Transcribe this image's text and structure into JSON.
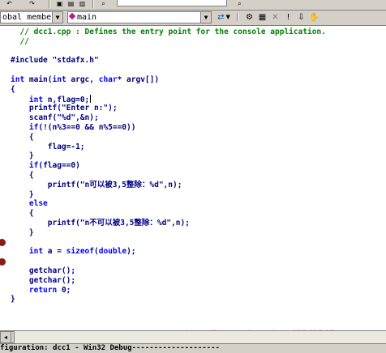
{
  "toolbar": {
    "combo_scope": "obal members",
    "combo_function": "main"
  },
  "editor": {
    "lines": [
      {
        "kind": "comment",
        "text": "  // dcc1.cpp : Defines the entry point for the console application."
      },
      {
        "kind": "comment",
        "text": "  //"
      },
      {
        "kind": "blank",
        "text": ""
      },
      {
        "kind": "code",
        "text": "#include \"stdafx.h\""
      },
      {
        "kind": "blank",
        "text": ""
      },
      {
        "kind": "code",
        "text": "int main(int argc, char* argv[])"
      },
      {
        "kind": "code",
        "text": "{"
      },
      {
        "kind": "code",
        "text": "    int n,flag=0;"
      },
      {
        "kind": "code",
        "text": "    printf(\"Enter n:\");"
      },
      {
        "kind": "code",
        "text": "    scanf(\"%d\",&n);"
      },
      {
        "kind": "code",
        "text": "    if(!(n%3==0 && n%5==0))"
      },
      {
        "kind": "code",
        "text": "    {"
      },
      {
        "kind": "code",
        "text": "        flag=-1;"
      },
      {
        "kind": "code",
        "text": "    }"
      },
      {
        "kind": "code",
        "text": "    if(flag==0)"
      },
      {
        "kind": "code",
        "text": "    {"
      },
      {
        "kind": "code",
        "text": "        printf(\"n可以被3,5整除：%d\",n);"
      },
      {
        "kind": "code",
        "text": "    }"
      },
      {
        "kind": "code",
        "text": "    else"
      },
      {
        "kind": "code",
        "text": "    {"
      },
      {
        "kind": "code",
        "text": "        printf(\"n不可以被3,5整除：%d\",n);"
      },
      {
        "kind": "code",
        "text": "    }"
      },
      {
        "kind": "blank",
        "text": ""
      },
      {
        "kind": "code",
        "text": "    int a = sizeof(double);"
      },
      {
        "kind": "blank",
        "text": ""
      },
      {
        "kind": "code",
        "text": "    getchar();"
      },
      {
        "kind": "code",
        "text": "    getchar();"
      },
      {
        "kind": "code",
        "text": "    return 0;"
      },
      {
        "kind": "code",
        "text": "}"
      }
    ],
    "breakpoint_lines": [
      22,
      24
    ]
  },
  "watermark": "https://blog.csdn.net/qq_45949348",
  "status": "figuration: dcc1 - Win32 Debug--------------------"
}
